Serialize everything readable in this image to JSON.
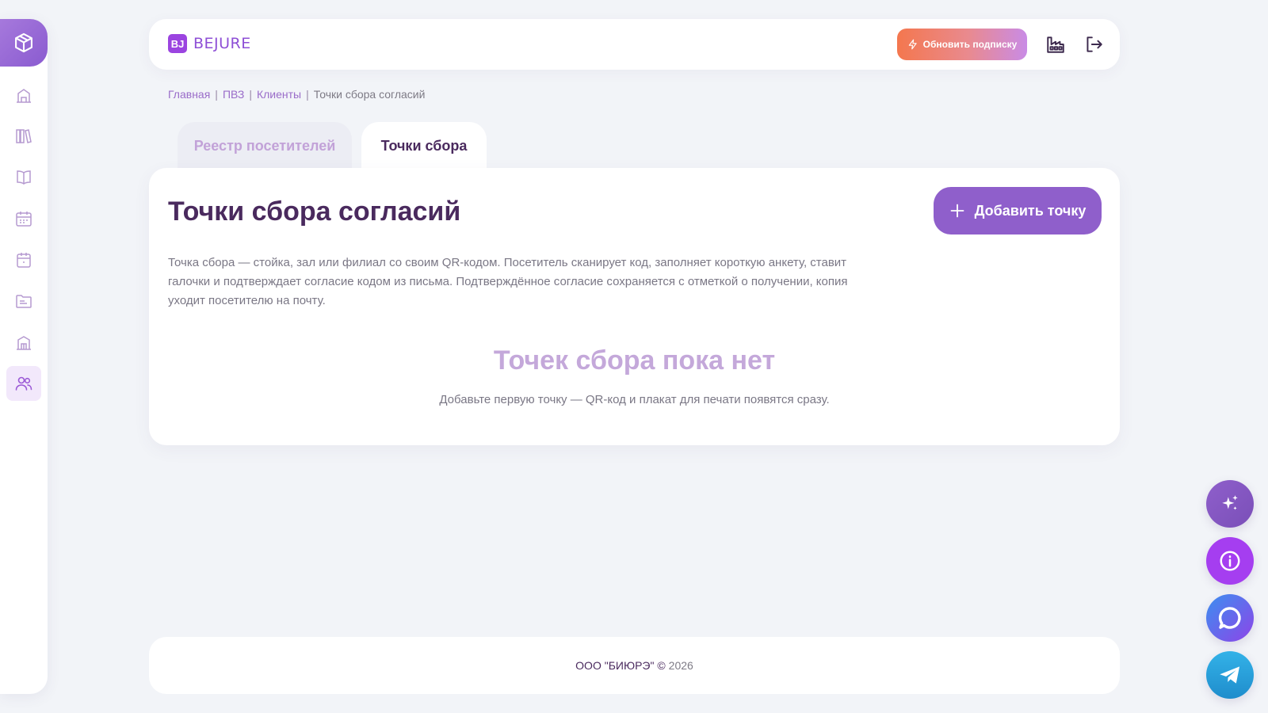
{
  "brand": {
    "badge": "BJ",
    "name": "BEJURE"
  },
  "header": {
    "upgrade_label": "Обновить подписку"
  },
  "breadcrumb": {
    "items": [
      "Главная",
      "ПВЗ",
      "Клиенты"
    ],
    "current": "Точки сбора согласий"
  },
  "tabs": [
    {
      "label": "Реестр посетителей",
      "active": false
    },
    {
      "label": "Точки сбора",
      "active": true
    }
  ],
  "main": {
    "title": "Точки сбора согласий",
    "add_button_label": "Добавить точку",
    "description": "Точка сбора — стойка, зал или филиал со своим QR-кодом. Посетитель сканирует код, заполняет короткую анкету, ставит галочки и подтверждает согласие кодом из письма. Подтверждённое согласие сохраняется с отметкой о получении, копия уходит посетителю на почту.",
    "empty_title": "Точек сбора пока нет",
    "empty_text": "Добавьте первую точку — QR-код и плакат для печати появятся сразу."
  },
  "footer": {
    "company": "ООО \"БИЮРЭ\" ©",
    "year": "2026"
  },
  "sidebar": {
    "items": [
      {
        "icon": "building-icon",
        "active": false
      },
      {
        "icon": "library-icon",
        "active": false
      },
      {
        "icon": "book-icon",
        "active": false
      },
      {
        "icon": "calendar-grid-icon",
        "active": false
      },
      {
        "icon": "calendar-icon",
        "active": false
      },
      {
        "icon": "folder-icon",
        "active": false
      },
      {
        "icon": "warehouse-icon",
        "active": false
      },
      {
        "icon": "users-icon",
        "active": true
      }
    ]
  },
  "colors": {
    "accent": "#8f5fcb",
    "title": "#4a2a5e",
    "background": "#f2f4f8"
  }
}
